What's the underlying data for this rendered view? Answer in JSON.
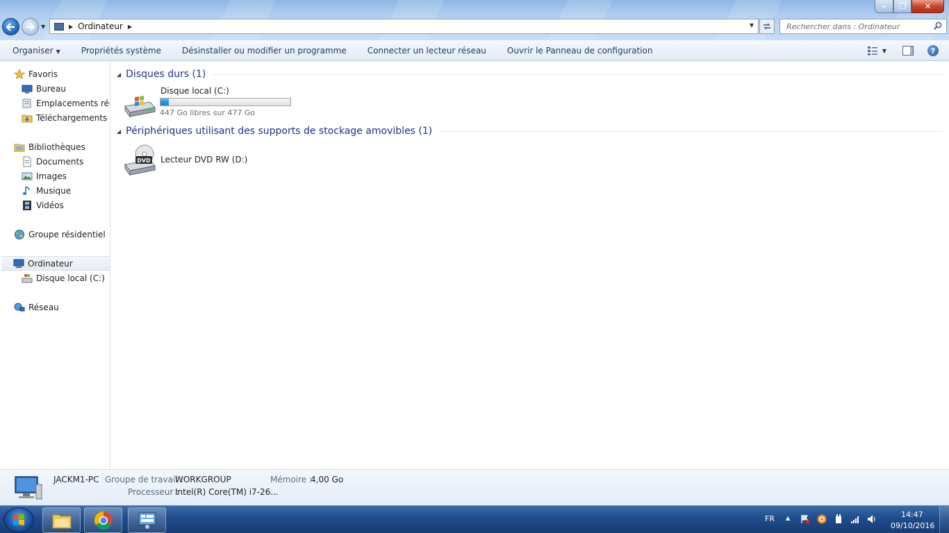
{
  "window": {
    "minimize_label": "–",
    "maximize_label": "❐",
    "close_label": "✕"
  },
  "navigation": {
    "address_path": [
      "Ordinateur"
    ],
    "search_placeholder": "Rechercher dans : Ordinateur"
  },
  "toolbar": {
    "organize_label": "Organiser",
    "system_properties_label": "Propriétés système",
    "uninstall_label": "Désinstaller ou modifier un programme",
    "map_drive_label": "Connecter un lecteur réseau",
    "control_panel_label": "Ouvrir le Panneau de configuration"
  },
  "sidebar": {
    "favorites": {
      "label": "Favoris",
      "items": [
        "Bureau",
        "Emplacements récents",
        "Téléchargements"
      ]
    },
    "libraries": {
      "label": "Bibliothèques",
      "items": [
        "Documents",
        "Images",
        "Musique",
        "Vidéos"
      ]
    },
    "homegroup": "Groupe résidentiel",
    "computer": {
      "label": "Ordinateur",
      "items": [
        "Disque local (C:)"
      ]
    },
    "network": "Réseau"
  },
  "content": {
    "hard_disks": {
      "title": "Disques durs (1)",
      "drives": [
        {
          "name": "Disque local (C:)",
          "free_text": "447 Go libres sur 477 Go",
          "used_fraction": 0.063
        }
      ]
    },
    "removable": {
      "title": "Périphériques utilisant des supports de stockage amovibles (1)",
      "drives": [
        {
          "name": "Lecteur DVD RW (D:)",
          "icon_label": "DVD"
        }
      ]
    }
  },
  "details": {
    "computer_name": "JACKM1-PC",
    "workgroup_label": "Groupe de travail :",
    "workgroup_value": "WORKGROUP",
    "memory_label": "Mémoire :",
    "memory_value": "4,00 Go",
    "processor_label": "Processeur :",
    "processor_value": "Intel(R) Core(TM) i7-26..."
  },
  "taskbar": {
    "language": "FR",
    "time": "14:47",
    "date": "09/10/2016",
    "pinned": [
      "explorer-icon",
      "chrome-icon",
      "control-panel-icon"
    ]
  },
  "colors": {
    "group_title": "#1e3287",
    "drive_fill": "#2694db",
    "taskbar": "#1f4c8c"
  }
}
